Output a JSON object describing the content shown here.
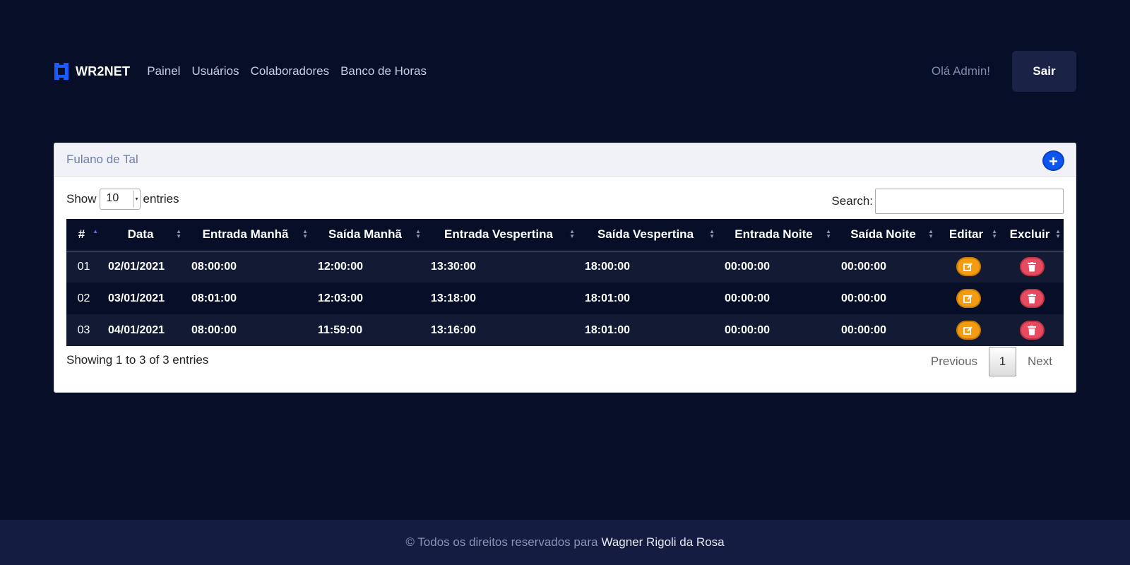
{
  "navbar": {
    "brand": "WR2NET",
    "links": [
      "Painel",
      "Usuários",
      "Colaboradores",
      "Banco de Horas"
    ],
    "greeting": "Olá Admin!",
    "logout_label": "Sair"
  },
  "card": {
    "title": "Fulano de Tal",
    "add_label": "+",
    "show_label": "Show",
    "entries_value": "10",
    "entries_label": "entries",
    "search_label": "Search:",
    "search_value": ""
  },
  "table": {
    "columns": [
      "#",
      "Data",
      "Entrada Manhã",
      "Saída Manhã",
      "Entrada Vespertina",
      "Saída Vespertina",
      "Entrada Noite",
      "Saída Noite",
      "Editar",
      "Excluir"
    ],
    "rows": [
      {
        "n": "01",
        "data": "02/01/2021",
        "em": "08:00:00",
        "sm": "12:00:00",
        "ev": "13:30:00",
        "sv": "18:00:00",
        "en": "00:00:00",
        "sn": "00:00:00"
      },
      {
        "n": "02",
        "data": "03/01/2021",
        "em": "08:01:00",
        "sm": "12:03:00",
        "ev": "13:18:00",
        "sv": "18:01:00",
        "en": "00:00:00",
        "sn": "00:00:00"
      },
      {
        "n": "03",
        "data": "04/01/2021",
        "em": "08:00:00",
        "sm": "11:59:00",
        "ev": "13:16:00",
        "sv": "18:01:00",
        "en": "00:00:00",
        "sn": "00:00:00"
      }
    ]
  },
  "pagination": {
    "info": "Showing 1 to 3 of 3 entries",
    "previous": "Previous",
    "page": "1",
    "next": "Next"
  },
  "footer": {
    "text": "© Todos os direitos reservados para",
    "author": "Wagner Rigoli da Rosa"
  },
  "colors": {
    "background": "#070e27",
    "accent": "#0d55f0",
    "edit": "#f39c12",
    "delete": "#e84a5f"
  }
}
